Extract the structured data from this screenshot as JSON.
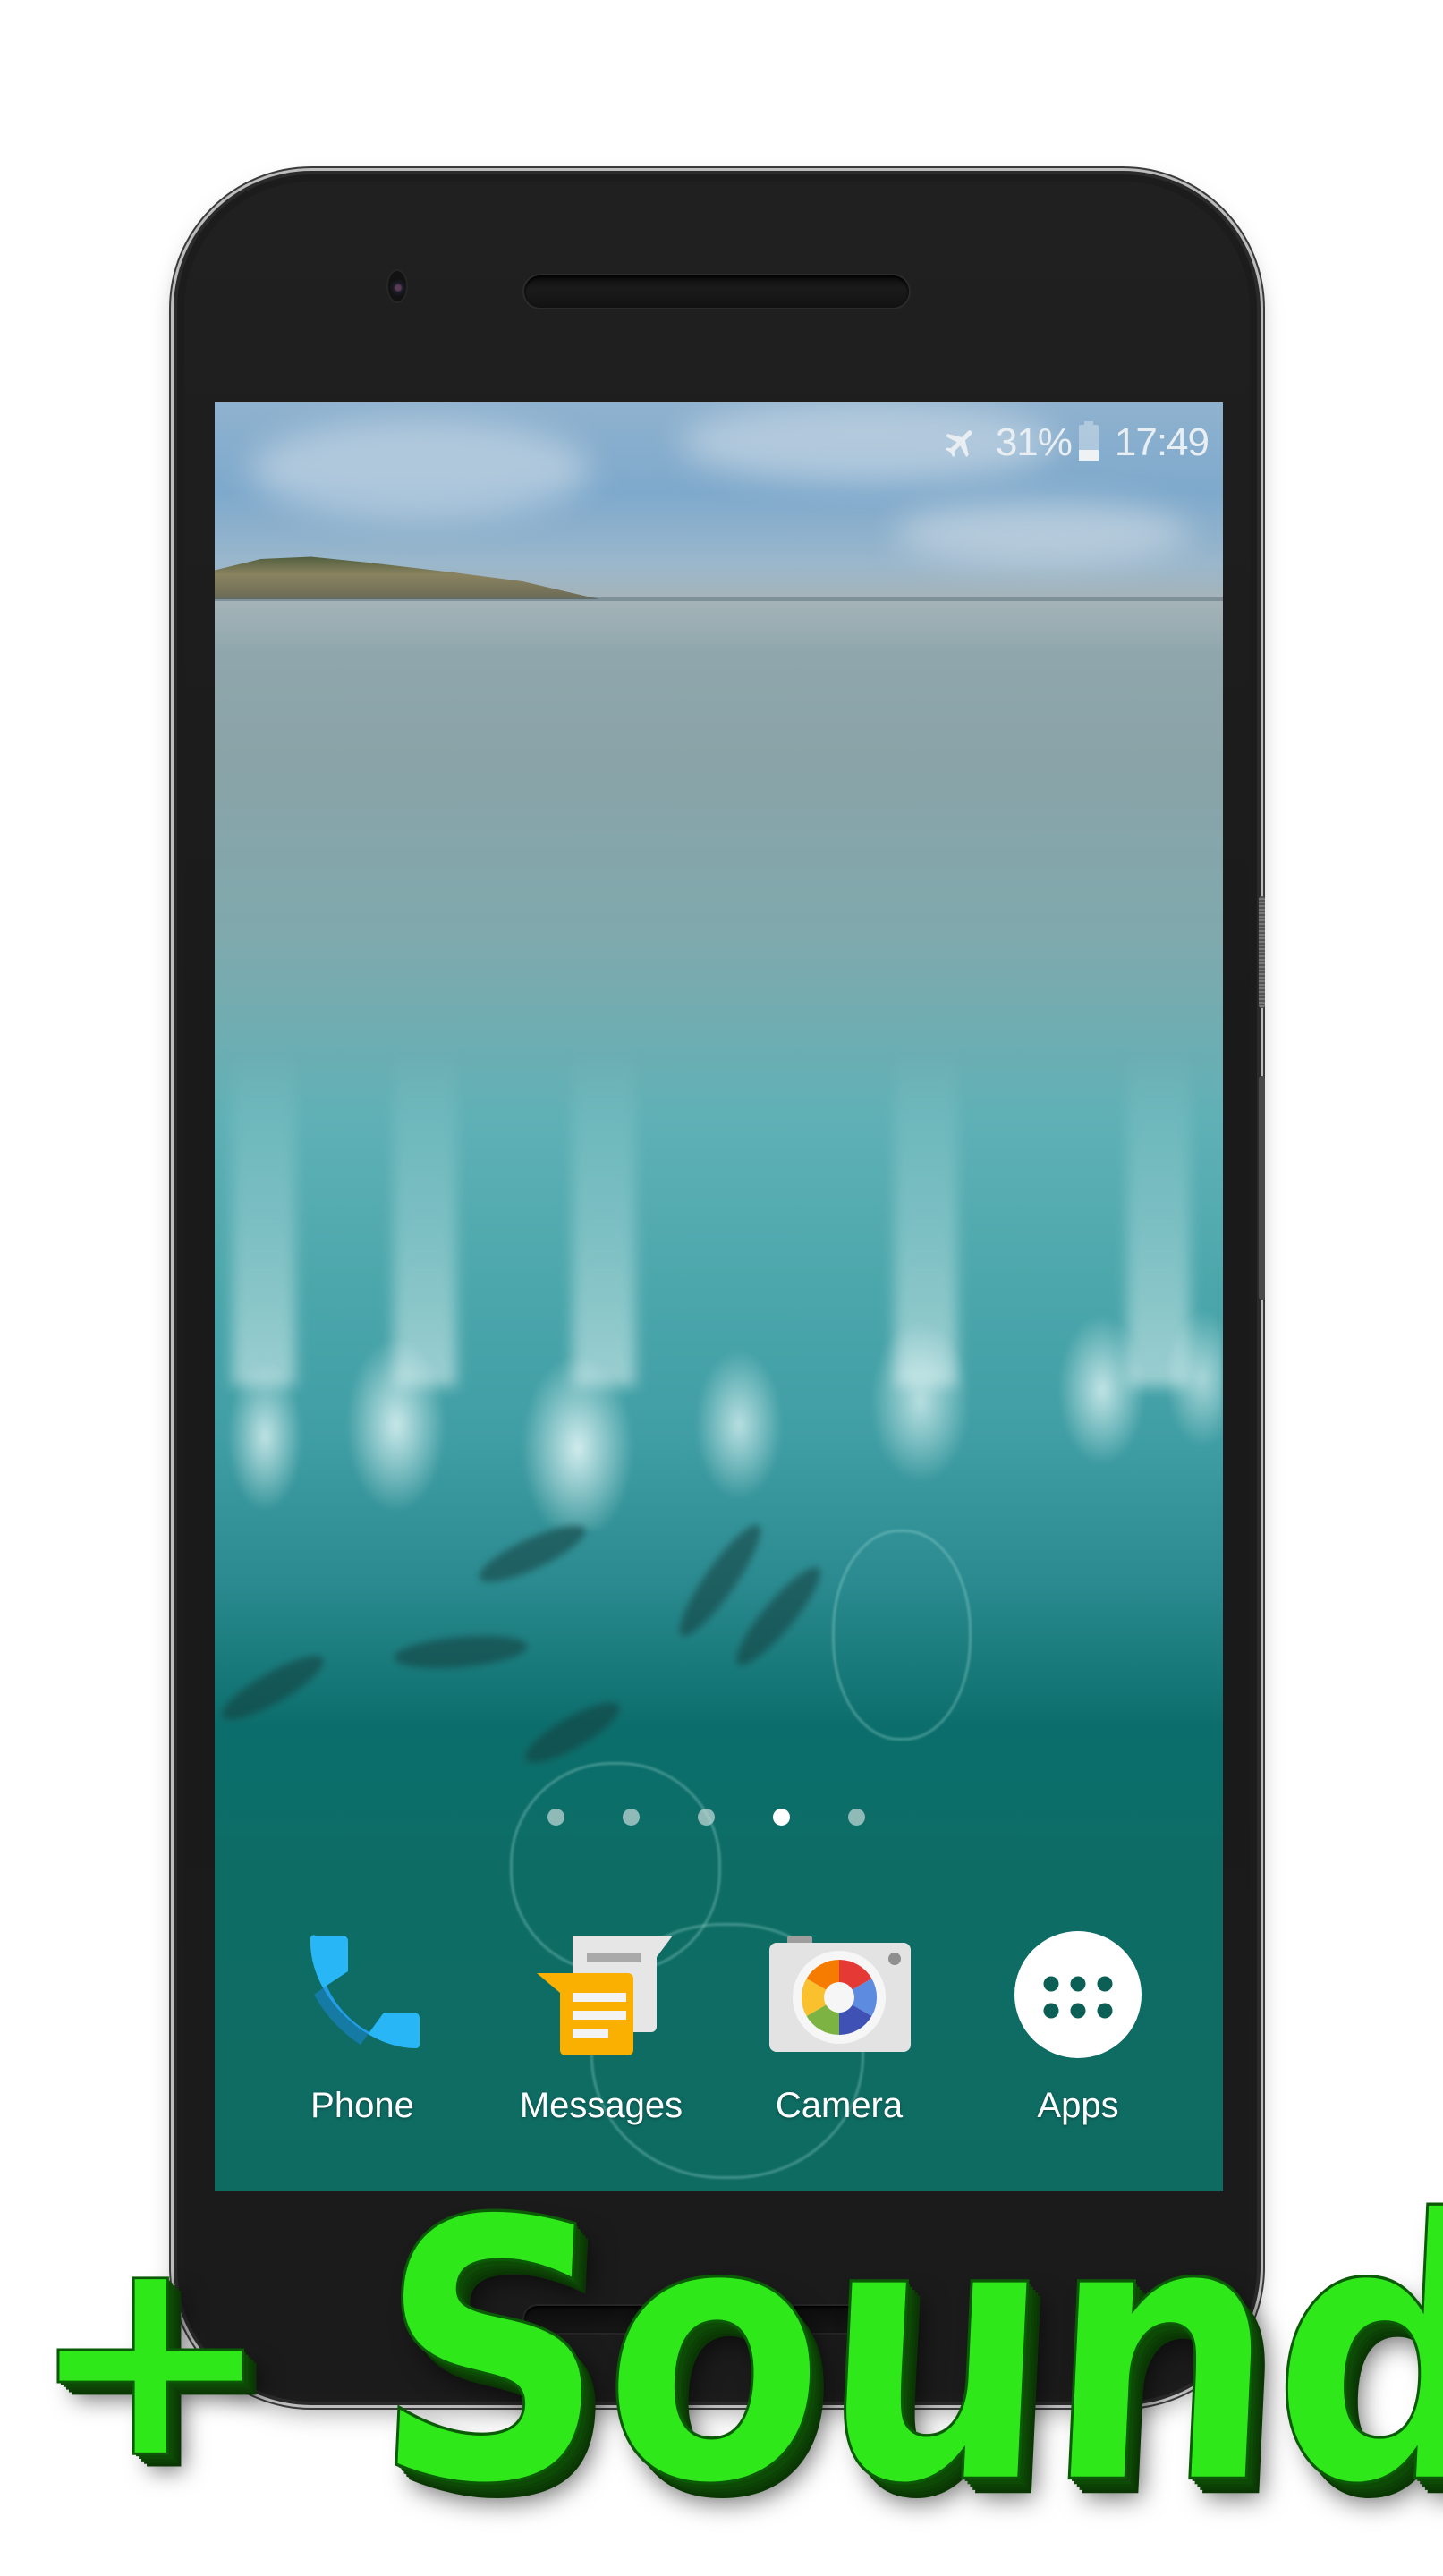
{
  "status_bar": {
    "airplane_mode_icon": "airplane-icon",
    "battery_percent_text": "31%",
    "battery_level": 0.31,
    "battery_icon": "battery-icon",
    "time": "17:49"
  },
  "wallpaper": {
    "description": "Live wallpaper: aerial ocean view with breaking wave, dolphins and island on horizon"
  },
  "home_screen": {
    "page_count": 5,
    "active_page": 4,
    "page_dots": [
      {
        "active": false
      },
      {
        "active": false
      },
      {
        "active": false
      },
      {
        "active": true
      },
      {
        "active": false
      }
    ]
  },
  "dock": {
    "items": [
      {
        "label": "Phone",
        "icon": "phone-icon"
      },
      {
        "label": "Messages",
        "icon": "messages-icon"
      },
      {
        "label": "Camera",
        "icon": "camera-icon"
      },
      {
        "label": "Apps",
        "icon": "apps-grid-icon"
      }
    ]
  },
  "promo": {
    "plus": "+",
    "word": "Sound",
    "color": "#2ee81a"
  },
  "colors": {
    "phone_blue": "#29b6f6",
    "messages_yellow": "#f9b000",
    "apps_dot": "#0c5f55"
  }
}
